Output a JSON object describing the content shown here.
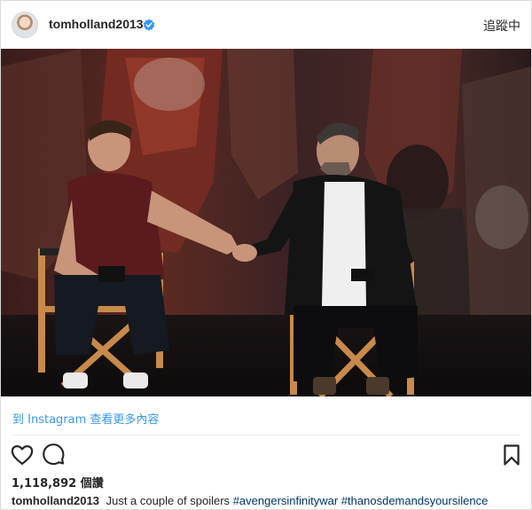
{
  "post": {
    "username": "tomholland2013",
    "verified": true,
    "follow_label": "追蹤中",
    "view_more_label": "到 Instagram 查看更多內容",
    "likes_count": "1,118,892",
    "likes_unit": "個讚",
    "caption_user": "tomholland2013",
    "caption_text": "Just a couple of spoilers",
    "hashtags": [
      "#avengersinfinitywar",
      "#thanosdemandsyoursilence"
    ]
  },
  "colors": {
    "link": "#3897f0",
    "verified": "#3897f0",
    "hashtag": "#003569",
    "text": "#262626",
    "border": "#dbdbdb"
  },
  "icons": {
    "like": "heart-icon",
    "comment": "comment-icon",
    "save": "bookmark-icon",
    "verified": "verified-badge-icon"
  }
}
